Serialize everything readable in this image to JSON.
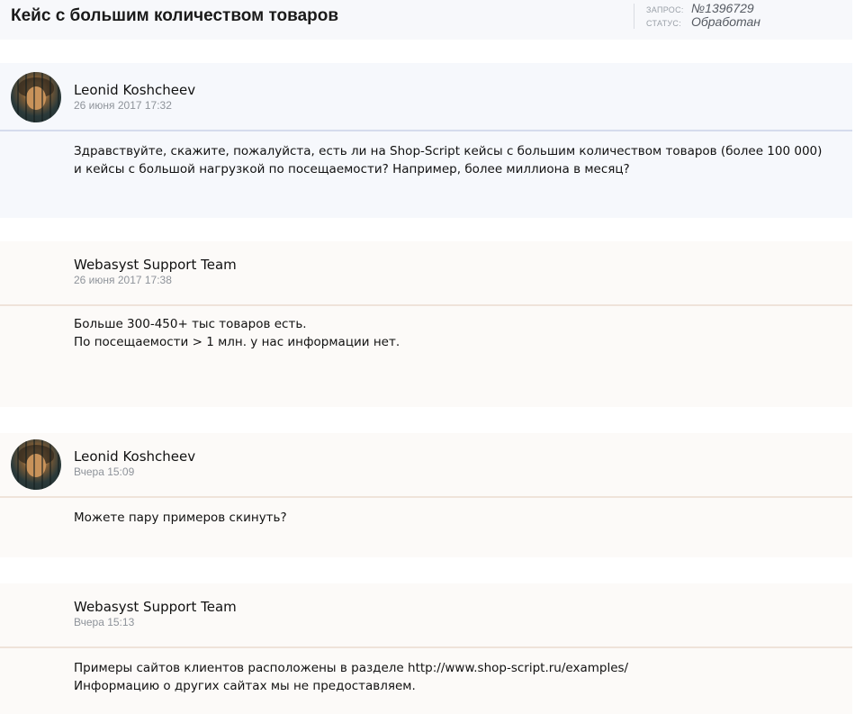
{
  "header": {
    "title": "Кейс с большим количеством товаров",
    "request_label": "ЗАПРОС:",
    "request_value": "№1396729",
    "status_label": "СТАТУС:",
    "status_value": "Обработан"
  },
  "messages": [
    {
      "author": "Leonid Koshcheev",
      "date": "26 июня 2017 17:32",
      "has_avatar": true,
      "lines": [
        "Здравствуйте, скажите, пожалуйста, есть ли на Shop-Script кейсы с большим количеством товаров (более 100 000) и кейсы с большой нагрузкой по посещаемости? Например, более миллиона в месяц?"
      ]
    },
    {
      "author": "Webasyst Support Team",
      "date": "26 июня 2017 17:38",
      "has_avatar": false,
      "lines": [
        "Больше 300-450+ тыс товаров есть.",
        "По посещаемости > 1 млн. у нас информации нет."
      ]
    },
    {
      "author": "Leonid Koshcheev",
      "date": "Вчера 15:09",
      "has_avatar": true,
      "lines": [
        "Можете пару примеров скинуть?"
      ]
    },
    {
      "author": "Webasyst Support Team",
      "date": "Вчера 15:13",
      "has_avatar": false,
      "lines": [
        "Примеры сайтов клиентов расположены в разделе http://www.shop-script.ru/examples/",
        "Информацию о других сайтах мы не предоставляем."
      ]
    }
  ]
}
